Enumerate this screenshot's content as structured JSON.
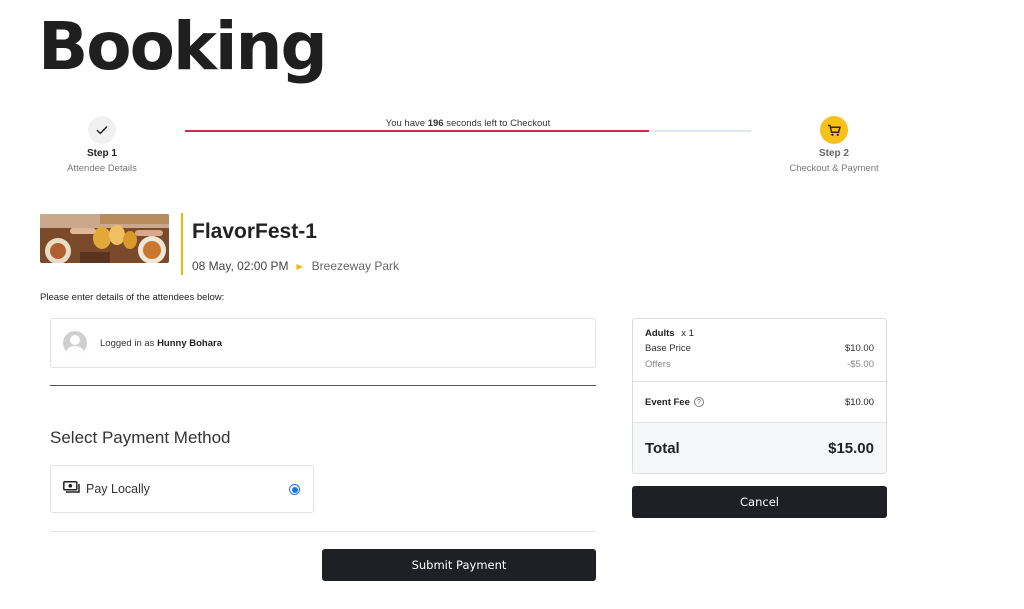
{
  "page": {
    "title": "Booking"
  },
  "stepper": {
    "step1": {
      "title": "Step 1",
      "subtitle": "Attendee Details",
      "icon": "check-icon"
    },
    "step2": {
      "title": "Step 2",
      "subtitle": "Checkout & Payment",
      "icon": "cart-icon",
      "color": "#f7c11a"
    },
    "timer": {
      "prefix": "You have",
      "seconds": "196",
      "suffix": "seconds left to Checkout",
      "progress_percent": 82,
      "bar_color": "#c7304a"
    }
  },
  "event": {
    "name": "FlavorFest-1",
    "datetime": "08 May, 02:00 PM",
    "venue": "Breezeway Park",
    "accent": "#f2b705"
  },
  "form": {
    "instructions": "Please enter details of the attendees below:",
    "login_prefix": "Logged in as",
    "login_user": "Hunny Bohara"
  },
  "payment": {
    "heading": "Select Payment Method",
    "options": [
      {
        "label": "Pay Locally",
        "selected": true,
        "icon": "cash-icon"
      }
    ],
    "submit_label": "Submit Payment"
  },
  "summary": {
    "ticket_type": "Adults",
    "quantity": "x 1",
    "base_price_label": "Base Price",
    "base_price": "$10.00",
    "offers_label": "Offers",
    "offers": "-$5.00",
    "fee_label": "Event Fee",
    "fee": "$10.00",
    "total_label": "Total",
    "total": "$15.00",
    "cancel_label": "Cancel"
  }
}
